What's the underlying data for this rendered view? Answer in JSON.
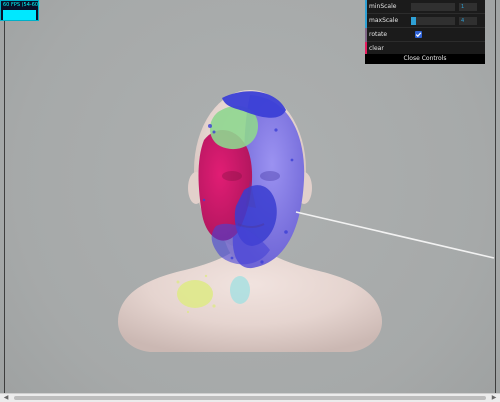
{
  "fps": {
    "label": "60 FPS (54-60)",
    "level": 1.0
  },
  "controls": {
    "rows": [
      {
        "label": "minScale",
        "value": "1",
        "fill_fraction": 0.0
      },
      {
        "label": "maxScale",
        "value": "4",
        "fill_fraction": 0.12
      },
      {
        "label": "rotate",
        "checked": true
      },
      {
        "label": "clear"
      }
    ],
    "close_label": "Close Controls"
  },
  "colors": {
    "background": "#a9acac",
    "panel": "#1b1b1b",
    "slider_accent": "#2fa1d6",
    "fps_accent": "#00ffff",
    "splat_magenta": "#d61c74",
    "splat_violet": "#8a7de6",
    "splat_blue": "#3b3fd6",
    "splat_green": "#8fd68f",
    "splat_yellow": "#dfe98a",
    "splat_cyan": "#a8dfe0",
    "head_skin": "#e7d7d2"
  }
}
